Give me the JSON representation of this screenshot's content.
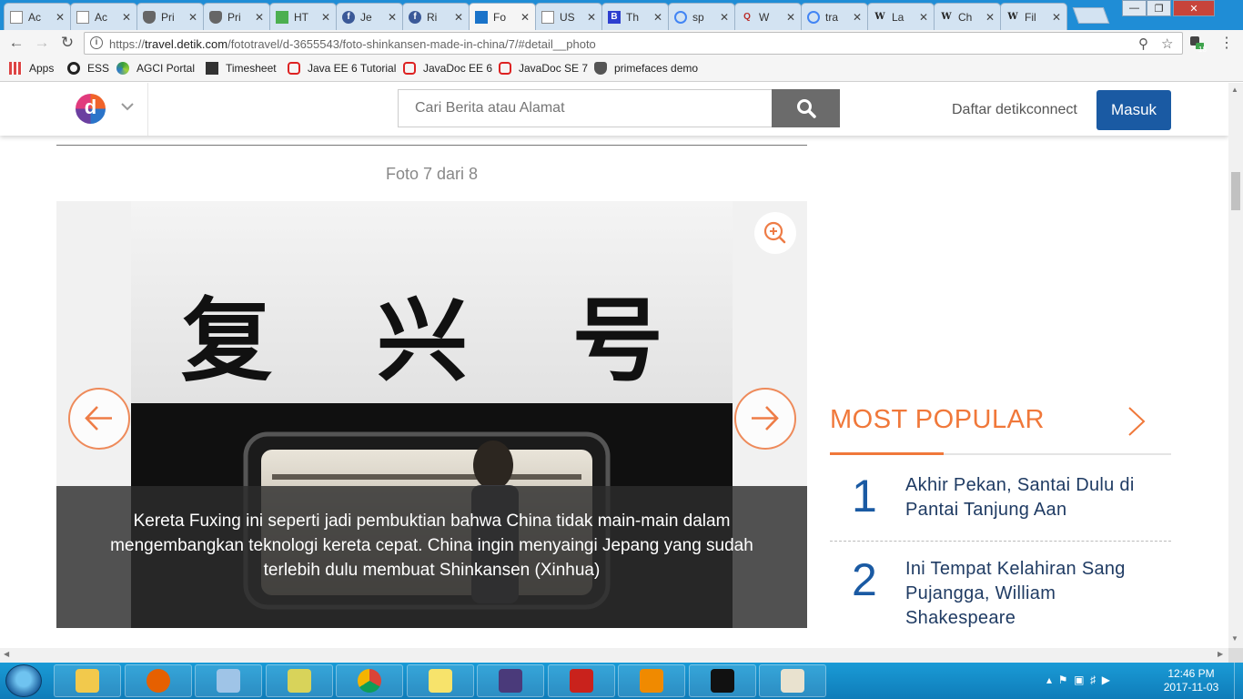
{
  "browser": {
    "tabs": [
      {
        "title": "Ac",
        "icon": "doc-icon"
      },
      {
        "title": "Ac",
        "icon": "doc-icon"
      },
      {
        "title": "Pri",
        "icon": "shield-icon"
      },
      {
        "title": "Pri",
        "icon": "shield-icon"
      },
      {
        "title": "HT",
        "icon": "bookmark-green-icon"
      },
      {
        "title": "Je",
        "icon": "facebook-icon"
      },
      {
        "title": "Ri",
        "icon": "facebook-icon"
      },
      {
        "title": "Fo",
        "icon": "detik-icon",
        "active": true
      },
      {
        "title": "US",
        "icon": "doc-icon"
      },
      {
        "title": "Th",
        "icon": "bold-b-icon"
      },
      {
        "title": "sp",
        "icon": "google-icon"
      },
      {
        "title": "W",
        "icon": "quora-icon"
      },
      {
        "title": "tra",
        "icon": "google-icon"
      },
      {
        "title": "La",
        "icon": "wikipedia-icon"
      },
      {
        "title": "Ch",
        "icon": "wikipedia-icon"
      },
      {
        "title": "Fil",
        "icon": "wikipedia-icon"
      }
    ],
    "url_prefix": "https://",
    "url_host": "travel.detik.com",
    "url_path": "/fototravel/d-3655543/foto-shinkansen-made-in-china/7/#detail__photo",
    "extension_badge": "18",
    "bookmarks": [
      {
        "label": "Apps"
      },
      {
        "label": "ESS"
      },
      {
        "label": "AGCI Portal"
      },
      {
        "label": "Timesheet"
      },
      {
        "label": "Java EE 6 Tutorial"
      },
      {
        "label": "JavaDoc EE 6"
      },
      {
        "label": "JavaDoc SE 7"
      },
      {
        "label": "primefaces demo"
      }
    ]
  },
  "site": {
    "logo_letter": "d",
    "search_placeholder": "Cari Berita atau Alamat",
    "register_label": "Daftar detikconnect",
    "login_label": "Masuk"
  },
  "gallery": {
    "counter": "Foto 7 dari 8",
    "photo_chinese_text": "复 兴 号",
    "caption": "Kereta Fuxing ini seperti jadi pembuktian bahwa China tidak main-main dalam mengembangkan teknologi kereta cepat. China ingin menyaingi Jepang yang sudah terlebih dulu membuat Shinkansen (Xinhua)"
  },
  "most_popular": {
    "title": "MOST POPULAR",
    "items": [
      {
        "rank": "1",
        "title": "Akhir Pekan, Santai Dulu di Pantai Tanjung Aan"
      },
      {
        "rank": "2",
        "title": "Ini Tempat Kelahiran Sang Pujangga, William Shakespeare"
      }
    ]
  },
  "taskbar": {
    "apps": [
      "file-explorer-icon",
      "firefox-icon",
      "notepad-icon",
      "chart-editor-icon",
      "chrome-icon",
      "sticky-notes-icon",
      "java-ee-ide-icon",
      "acrobat-icon",
      "vlc-icon",
      "cmd-icon",
      "paint-icon"
    ],
    "time": "12:46 PM",
    "date": "2017-11-03"
  },
  "colors": {
    "accent_orange": "#f0783a",
    "detik_blue": "#1a5aa3",
    "chrome_blue": "#1f8dd6"
  }
}
